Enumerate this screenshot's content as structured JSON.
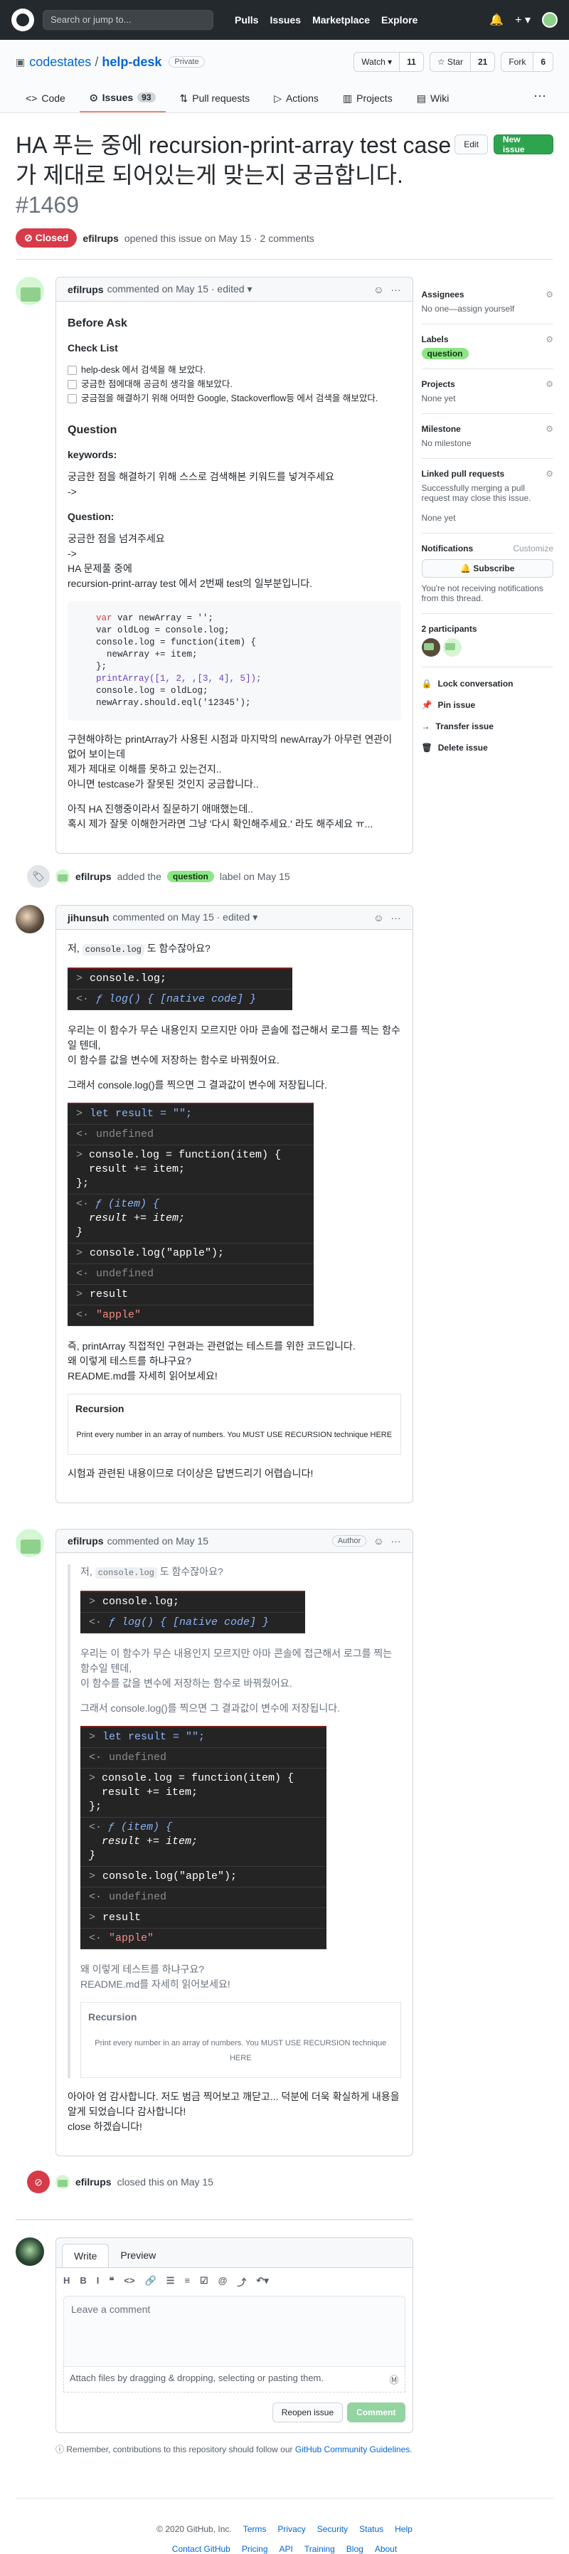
{
  "header": {
    "search_placeholder": "Search or jump to...",
    "nav": [
      "Pulls",
      "Issues",
      "Marketplace",
      "Explore"
    ],
    "plus": "+ ▾"
  },
  "repo": {
    "owner": "codestates",
    "sep": "/",
    "name": "help-desk",
    "visibility": "Private",
    "watch": "Watch ▾",
    "watch_count": "11",
    "star": "☆ Star",
    "star_count": "21",
    "fork": "Fork",
    "fork_count": "6"
  },
  "tabs": [
    {
      "label": "Code"
    },
    {
      "label": "Issues",
      "count": "93"
    },
    {
      "label": "Pull requests"
    },
    {
      "label": "Actions"
    },
    {
      "label": "Projects"
    },
    {
      "label": "Wiki"
    }
  ],
  "issue": {
    "title": "HA 푸는 중에 recursion-print-array test case 가 제대로 되어있는게 맞는지 궁금합니다.",
    "number": "#1469",
    "edit": "Edit",
    "new_issue": "New issue",
    "status": "Closed",
    "author": "efilrups",
    "opened": "opened this issue on May 15 · 2 comments"
  },
  "c1": {
    "author": "efilrups",
    "meta": "commented on May 15 · edited ▾",
    "h_before": "Before Ask",
    "h_check": "Check List",
    "checks": [
      "help-desk 에서 검색을 해 보았다.",
      "궁금한 점에대해 공금히 생각을 해보았다.",
      "궁금점을 해결하기 위해 어떠한 Google, Stackoverflow등 에서 검색을 해보았다."
    ],
    "h_question": "Question",
    "kw_label": "keywords:",
    "kw_text": "궁금한 점을 해결하기 위해 스스로 검색해본 키워드를 넣겨주세요",
    "arrow": "->",
    "q_label": "Question:",
    "q1": "궁금한 점을 넘겨주세요",
    "q2": "->",
    "q3": "HA 문제풀 중에",
    "q4": "recursion-print-array test 에서 2번째 test의 일부분입니다.",
    "code": [
      "var newArray = '';",
      "var oldLog = console.log;",
      "console.log = function(item) {",
      "  newArray += item;",
      "};",
      "printArray([1, 2, ,[3, 4], 5]);",
      "console.log = oldLog;",
      "newArray.should.eql('12345');"
    ],
    "p1a": "구현해야하는 printArray가 사용된 시점과 마지막의 newArray가 아무런 연관이 없어 보이는데",
    "p1b": "제가 제대로 이해를 못하고 있는건지..",
    "p1c": "아니면 testcase가 잘못된 것인지 궁금합니다..",
    "p2a": "아직 HA 진행중이라서 질문하기 애매했는데..",
    "p2b": "혹시 제가 잘못 이해한거라면 그냥 '다시 확인해주세요.' 라도 해주세요 ㅠ..."
  },
  "ev1": {
    "user": "efilrups",
    "text1": "added the",
    "label": "question",
    "text2": "label on May 15"
  },
  "c2": {
    "author": "jihunsuh",
    "meta": "commented on May 15 · edited ▾",
    "p1a": "저,",
    "p1code": "console.log",
    "p1b": "도 함수잖아요?",
    "con1": [
      "console.log;",
      "ƒ log() { [native code] }"
    ],
    "p2a": "우리는 이 함수가 무슨 내용인지 모르지만 아마 콘솔에 접근해서 로그를 찍는 함수일 텐데,",
    "p2b": "이 함수를 값을 변수에 저장하는 함수로 바꿔줬어요.",
    "p3": "그래서 console.log()를 찍으면 그 결과값이 변수에 저장됩니다.",
    "con2": [
      "let result = \"\";",
      "undefined",
      "console.log = function(item) {",
      "  result += item;",
      "};",
      "ƒ (item) {",
      "  result += item;",
      "}",
      "console.log(\"apple\");",
      "undefined",
      "result",
      "\"apple\""
    ],
    "p4a": "즉, printArray 직접적인 구현과는 관련없는 테스트를 위한 코드입니다.",
    "p4b": "왜 이렇게 테스트를 하냐구요?",
    "p4c": "README.md를 자세히 읽어보세요!",
    "rec_title": "Recursion",
    "rec_text": "Print every number in an array of numbers. You MUST USE RECURSION technique HERE",
    "p5": "시험과 관련된 내용이므로 더이상은 답변드리기 어렵습니다!"
  },
  "c3": {
    "author": "efilrups",
    "meta": "commented on May 15",
    "badge": "Author",
    "q_p1a": "저,",
    "q_p1code": "console.log",
    "q_p1b": "도 함수잖아요?",
    "q_p2a": "우리는 이 함수가 무슨 내용인지 모르지만 아마 콘솔에 접근해서 로그를 찍는 함수일 텐데,",
    "q_p2b": "이 함수를 값을 변수에 저장하는 함수로 바꿔줬어요.",
    "q_p3": "그래서 console.log()를 찍으면 그 결과값이 변수에 저장됩니다.",
    "q_p4a": "왜 이렇게 테스트를 하냐구요?",
    "q_p4b": "README.md를 자세히 읽어보세요!",
    "rec_title": "Recursion",
    "rec_text": "Print every number in an array of numbers. You MUST USE RECURSION technique HERE",
    "p1a": "아아아 엄 감사합니다. 저도 범금 찍어보고 깨닫고... 덕분에 더욱 확실하게 내용을 알게 되었습니다 감사합니다!",
    "p1b": "close 하겠습니다!"
  },
  "ev2": {
    "user": "efilrups",
    "text": "closed this on May 15"
  },
  "new_comment": {
    "write": "Write",
    "preview": "Preview",
    "tools": [
      "H",
      "B",
      "I",
      "❝",
      "<>",
      "🔗",
      "☰",
      "≡",
      "☑",
      "@",
      "⤴",
      "↶▾"
    ],
    "placeholder": "Leave a comment",
    "attach": "Attach files by dragging & dropping, selecting or pasting them.",
    "reopen": "Reopen issue",
    "submit": "Comment",
    "note_a": "Remember, contributions to this repository should follow our",
    "note_link": "GitHub Community Guidelines",
    "note_b": "."
  },
  "sidebar": {
    "assignees_t": "Assignees",
    "assignees_v": "No one—assign yourself",
    "labels_t": "Labels",
    "labels_v": "question",
    "projects_t": "Projects",
    "projects_v": "None yet",
    "milestone_t": "Milestone",
    "milestone_v": "No milestone",
    "linked_t": "Linked pull requests",
    "linked_v": "Successfully merging a pull request may close this issue.",
    "linked_v2": "None yet",
    "notif_t": "Notifications",
    "notif_custom": "Customize",
    "subscribe": "Subscribe",
    "notif_v": "You're not receiving notifications from this thread.",
    "part_t": "2 participants",
    "lock": "Lock conversation",
    "pin": "Pin issue",
    "transfer": "Transfer issue",
    "delete": "Delete issue"
  },
  "footer": {
    "copy": "© 2020 GitHub, Inc.",
    "row1": [
      "Terms",
      "Privacy",
      "Security",
      "Status",
      "Help"
    ],
    "row2": [
      "Contact GitHub",
      "Pricing",
      "API",
      "Training",
      "Blog",
      "About"
    ]
  }
}
